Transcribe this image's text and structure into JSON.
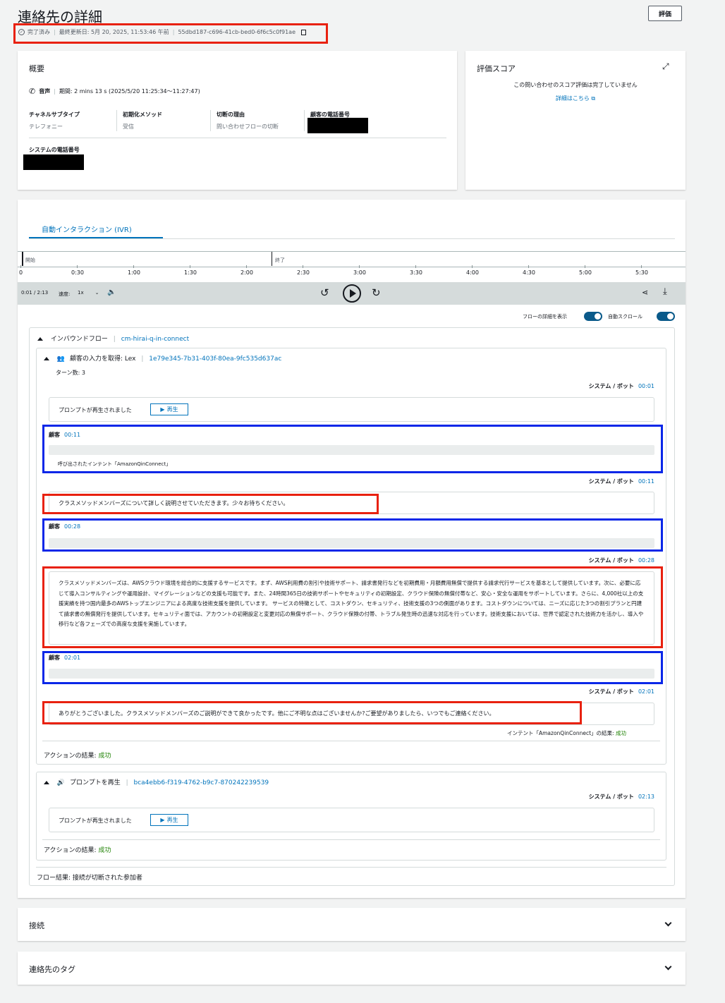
{
  "header": {
    "title": "連絡先の詳細",
    "status": "完了済み",
    "last_updated": "最終更新日: 5月 20, 2025, 11:53:46 午前",
    "contact_id": "55dbd187-c696-41cb-bed0-6f6c5c0f91ae",
    "evaluate_label": "評価"
  },
  "overview": {
    "title": "概要",
    "channel": "音声",
    "duration": "期間: 2 mins 13 s (2025/5/20 11:25:34～11:27:47)",
    "fields": [
      {
        "label": "チャネルサブタイプ",
        "value": "テレフォニー"
      },
      {
        "label": "初期化メソッド",
        "value": "受信"
      },
      {
        "label": "切断の理由",
        "value": "問い合わせフローの切断"
      },
      {
        "label": "顧客の電話番号",
        "value": ""
      }
    ],
    "system_phone_label": "システムの電話番号"
  },
  "score": {
    "title": "評価スコア",
    "message": "この問い合わせのスコア評価は完了していません",
    "link": "詳細はこちら"
  },
  "ivr": {
    "tab": "自動インタラクション (IVR)",
    "start_label": "開始",
    "end_label": "終了",
    "ticks": [
      "0",
      "0:30",
      "1:00",
      "1:30",
      "2:00",
      "2:30",
      "3:00",
      "3:30",
      "4:00",
      "4:30",
      "5:00",
      "5:30"
    ],
    "time": "0:01 / 2:13",
    "speed_label": "速度:",
    "speed_value": "1x",
    "toggle_flow": "フローの詳細を表示",
    "toggle_scroll": "自動スクロール"
  },
  "flow": {
    "inbound_label": "インバウンドフロー",
    "inbound_name": "cm-hirai-q-in-connect",
    "lex_block": {
      "title": "顧客の入力を取得: Lex",
      "id": "1e79e345-7b31-403f-80ea-9fc535d637ac",
      "turns": "ターン数: 3",
      "system_label": "システム / ボット",
      "customer_label": "顧客",
      "t_sys1": "00:01",
      "prompt_played": "プロンプトが再生されました",
      "play_label": "再生",
      "t_cust1": "00:11",
      "intent_called": "呼び出されたインテント「AmazonQinConnect」",
      "t_sys2": "00:11",
      "msg1": "クラスメソッドメンバーズについて詳しく説明させていただきます。少々お待ちください。",
      "t_cust2": "00:28",
      "t_sys3": "00:28",
      "msg2": "クラスメソッドメンバーズは、AWSクラウド環境を総合的に支援するサービスです。まず、AWS利用費の割引や技術サポート、請求書発行などを初期費用・月額費用無償で提供する請求代行サービスを基本として提供しています。次に、必要に応じて導入コンサルティングや運用設計、マイグレーションなどの支援も可能です。また、24時間365日の技術サポートやセキュリティの初期設定、クラウド保険の無償付帯など、安心・安全な運用をサポートしています。さらに、4,000社以上の支援実績を持つ国内最多のAWSトップエンジニアによる高度な技術支援を提供しています。 サービスの特徴として、コストダウン、セキュリティ、技術支援の3つの側面があります。コストダウンについては、ニーズに応じた3つの割引プランと円建て請求書の無償発行を提供しています。セキュリティ面では、アカウントの初期設定と変更対応の無償サポート、クラウド保険の付帯、トラブル発生時の迅速な対応を行っています。技術支援においては、世界で認定された技術力を活かし、導入や移行など各フェーズでの高度な支援を実施しています。",
      "t_cust3": "02:01",
      "t_sys4": "02:01",
      "msg3": "ありがとうございました。クラスメソッドメンバーズのご説明ができて良かったです。他にご不明な点はございませんか?ご要望がありましたら、いつでもご連絡ください。",
      "intent_result_label": "インテント「AmazonQinConnect」の結果:",
      "intent_result_value": "成功",
      "action_result_label": "アクションの結果:",
      "action_result_value": "成功"
    },
    "prompt_block": {
      "title": "プロンプトを再生",
      "id": "bca4ebb6-f319-4762-b9c7-870242239539",
      "system_label": "システム / ボット",
      "t_sys": "02:13",
      "prompt_played": "プロンプトが再生されました",
      "play_label": "再生",
      "action_result_label": "アクションの結果:",
      "action_result_value": "成功"
    },
    "flow_result": "フロー結果: 接続が切断された参加者"
  },
  "sections": {
    "connection": "接続",
    "tags": "連絡先のタグ"
  }
}
